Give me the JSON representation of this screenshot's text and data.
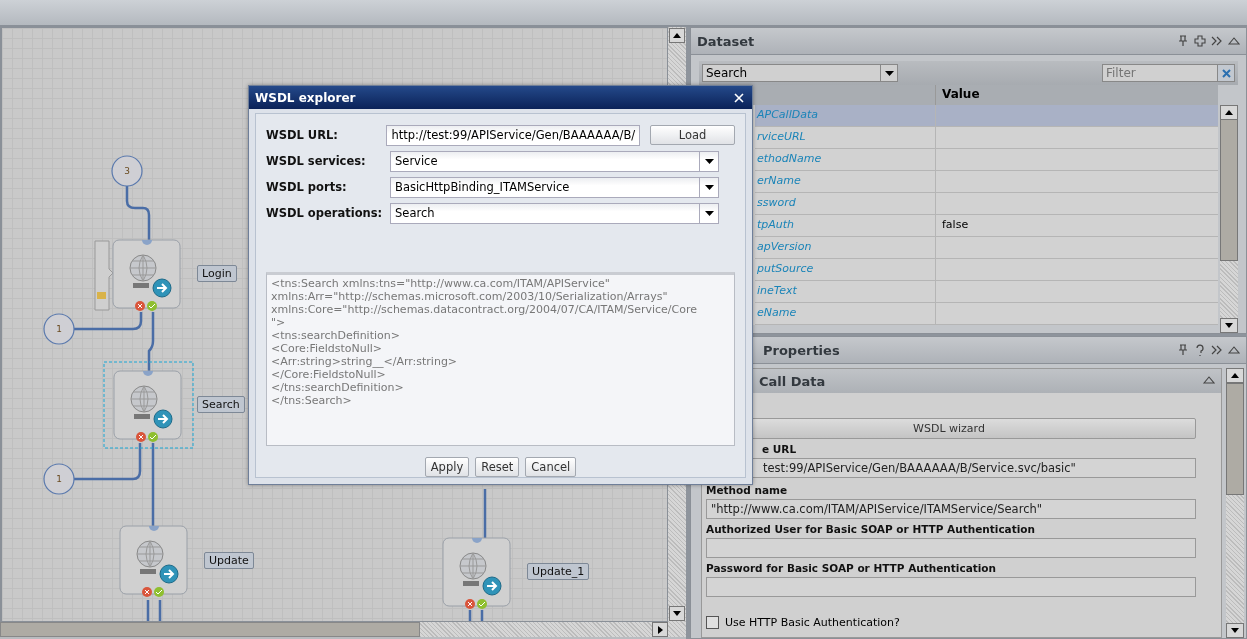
{
  "canvas": {
    "nodes": [
      {
        "kind": "counter",
        "label": "3"
      },
      {
        "kind": "service",
        "label": "Login",
        "selected": false,
        "tab": true
      },
      {
        "kind": "counter",
        "label": "1"
      },
      {
        "kind": "service",
        "label": "Search",
        "selected": true,
        "tab": false
      },
      {
        "kind": "counter",
        "label": "1"
      },
      {
        "kind": "service",
        "label": "Update",
        "selected": false,
        "tab": false
      },
      {
        "kind": "service",
        "label": "Update_1",
        "selected": false,
        "tab": false
      }
    ]
  },
  "dataset": {
    "title": "Dataset",
    "source": "Search",
    "filter": {
      "placeholder": "Filter"
    },
    "value_column": "Value",
    "rows": [
      {
        "name": "APCallData",
        "selected": true
      },
      {
        "name": "rviceURL",
        "selected": false
      },
      {
        "name": "ethodName",
        "selected": false
      },
      {
        "name": "erName",
        "selected": false
      },
      {
        "name": "ssword",
        "selected": false
      },
      {
        "name": "tpAuth",
        "value": "false",
        "selected": false
      },
      {
        "name": "apVersion",
        "selected": false
      },
      {
        "name": "putSource",
        "selected": false
      },
      {
        "name": "ineText",
        "selected": false
      },
      {
        "name": "eName",
        "selected": false
      }
    ]
  },
  "properties": {
    "title": "Properties",
    "section": {
      "title": "Call Data",
      "expanded": true
    },
    "wizard_button": "WSDL wizard",
    "fields": [
      {
        "label": "e URL",
        "value": "test:99/APIService/Gen/BAAAAAA/B/Service.svc/basic\""
      },
      {
        "label": "Method name",
        "value": "\"http://www.ca.com/ITAM/APIService/ITAMService/Search\""
      },
      {
        "label": "Authorized User for Basic SOAP or HTTP Authentication"
      },
      {
        "label": "Password for Basic SOAP or HTTP Authentication"
      }
    ],
    "checkbox": {
      "label": "Use HTTP Basic Authentication?",
      "checked": false
    }
  },
  "dialog": {
    "title": "WSDL explorer",
    "fields": [
      {
        "kind": "text",
        "label": "WSDL URL:",
        "value": "http://test:99/APIService/Gen/BAAAAAA/B/",
        "button": "Load"
      },
      {
        "kind": "select",
        "label": "WSDL services:",
        "value": "Service"
      },
      {
        "kind": "select",
        "label": "WSDL ports:",
        "value": "BasicHttpBinding_ITAMService"
      },
      {
        "kind": "select",
        "label": "WSDL operations:",
        "value": "Search"
      }
    ],
    "request": "<tns:Search xmlns:tns=\"http://www.ca.com/ITAM/APIService\"\nxmlns:Arr=\"http://schemas.microsoft.com/2003/10/Serialization/Arrays\"\nxmlns:Core=\"http://schemas.datacontract.org/2004/07/CA/ITAM/Service/Core\n\">\n<tns:searchDefinition>\n<Core:FieldstoNull>\n<Arr:string>string__</Arr:string>\n</Core:FieldstoNull>\n</tns:searchDefinition>\n</tns:Search>",
    "buttons": [
      "Apply",
      "Reset",
      "Cancel"
    ]
  }
}
